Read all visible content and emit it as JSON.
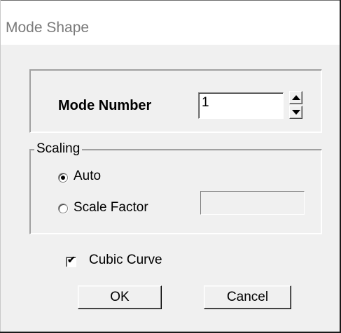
{
  "window": {
    "title": "Mode Shape"
  },
  "mode": {
    "label": "Mode Number",
    "value": "1"
  },
  "scaling": {
    "legend": "Scaling",
    "options": [
      {
        "label": "Auto",
        "selected": true
      },
      {
        "label": "Scale Factor",
        "selected": false
      }
    ],
    "scale_factor_value": ""
  },
  "cubic_curve": {
    "label": "Cubic Curve",
    "checked": true
  },
  "buttons": {
    "ok": "OK",
    "cancel": "Cancel"
  },
  "colors": {
    "face": "#f0f0f0",
    "title_text": "#7a7a7a"
  }
}
